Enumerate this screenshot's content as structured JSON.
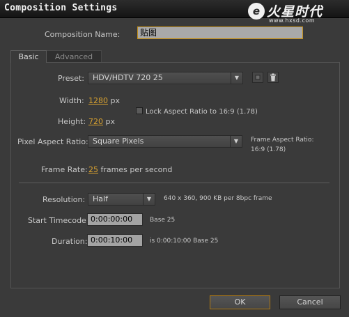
{
  "window": {
    "title": "Composition Settings"
  },
  "watermark": {
    "brand": "火星时代",
    "url": "www.hxsd.com",
    "logo_icon": "e"
  },
  "composition_name": {
    "label": "Composition Name:",
    "value": "贴图"
  },
  "tabs": [
    {
      "label": "Basic",
      "active": true
    },
    {
      "label": "Advanced",
      "active": false
    }
  ],
  "preset": {
    "label": "Preset:",
    "value": "HDV/HDTV 720 25"
  },
  "width": {
    "label": "Width:",
    "value": "1280",
    "unit": "px"
  },
  "height": {
    "label": "Height:",
    "value": "720",
    "unit": "px"
  },
  "lock_aspect": {
    "label": "Lock Aspect Ratio to 16:9 (1.78)",
    "checked": false
  },
  "pixel_aspect": {
    "label": "Pixel Aspect Ratio:",
    "value": "Square Pixels"
  },
  "frame_aspect": {
    "line1": "Frame Aspect Ratio:",
    "line2": "16:9 (1.78)"
  },
  "frame_rate": {
    "label": "Frame Rate:",
    "value": "25",
    "unit": "frames per second"
  },
  "resolution": {
    "label": "Resolution:",
    "value": "Half",
    "info": "640 x 360, 900 KB per 8bpc frame"
  },
  "start_timecode": {
    "label": "Start Timecode:",
    "value": "0:00:00:00",
    "info": "Base 25"
  },
  "duration": {
    "label": "Duration:",
    "value": "0:00:10:00",
    "info": "is 0:00:10:00  Base 25"
  },
  "buttons": {
    "ok": "OK",
    "cancel": "Cancel"
  },
  "colors": {
    "accent": "#d9a230",
    "ok_border": "#b27a12",
    "background": "#3a3a3a"
  }
}
